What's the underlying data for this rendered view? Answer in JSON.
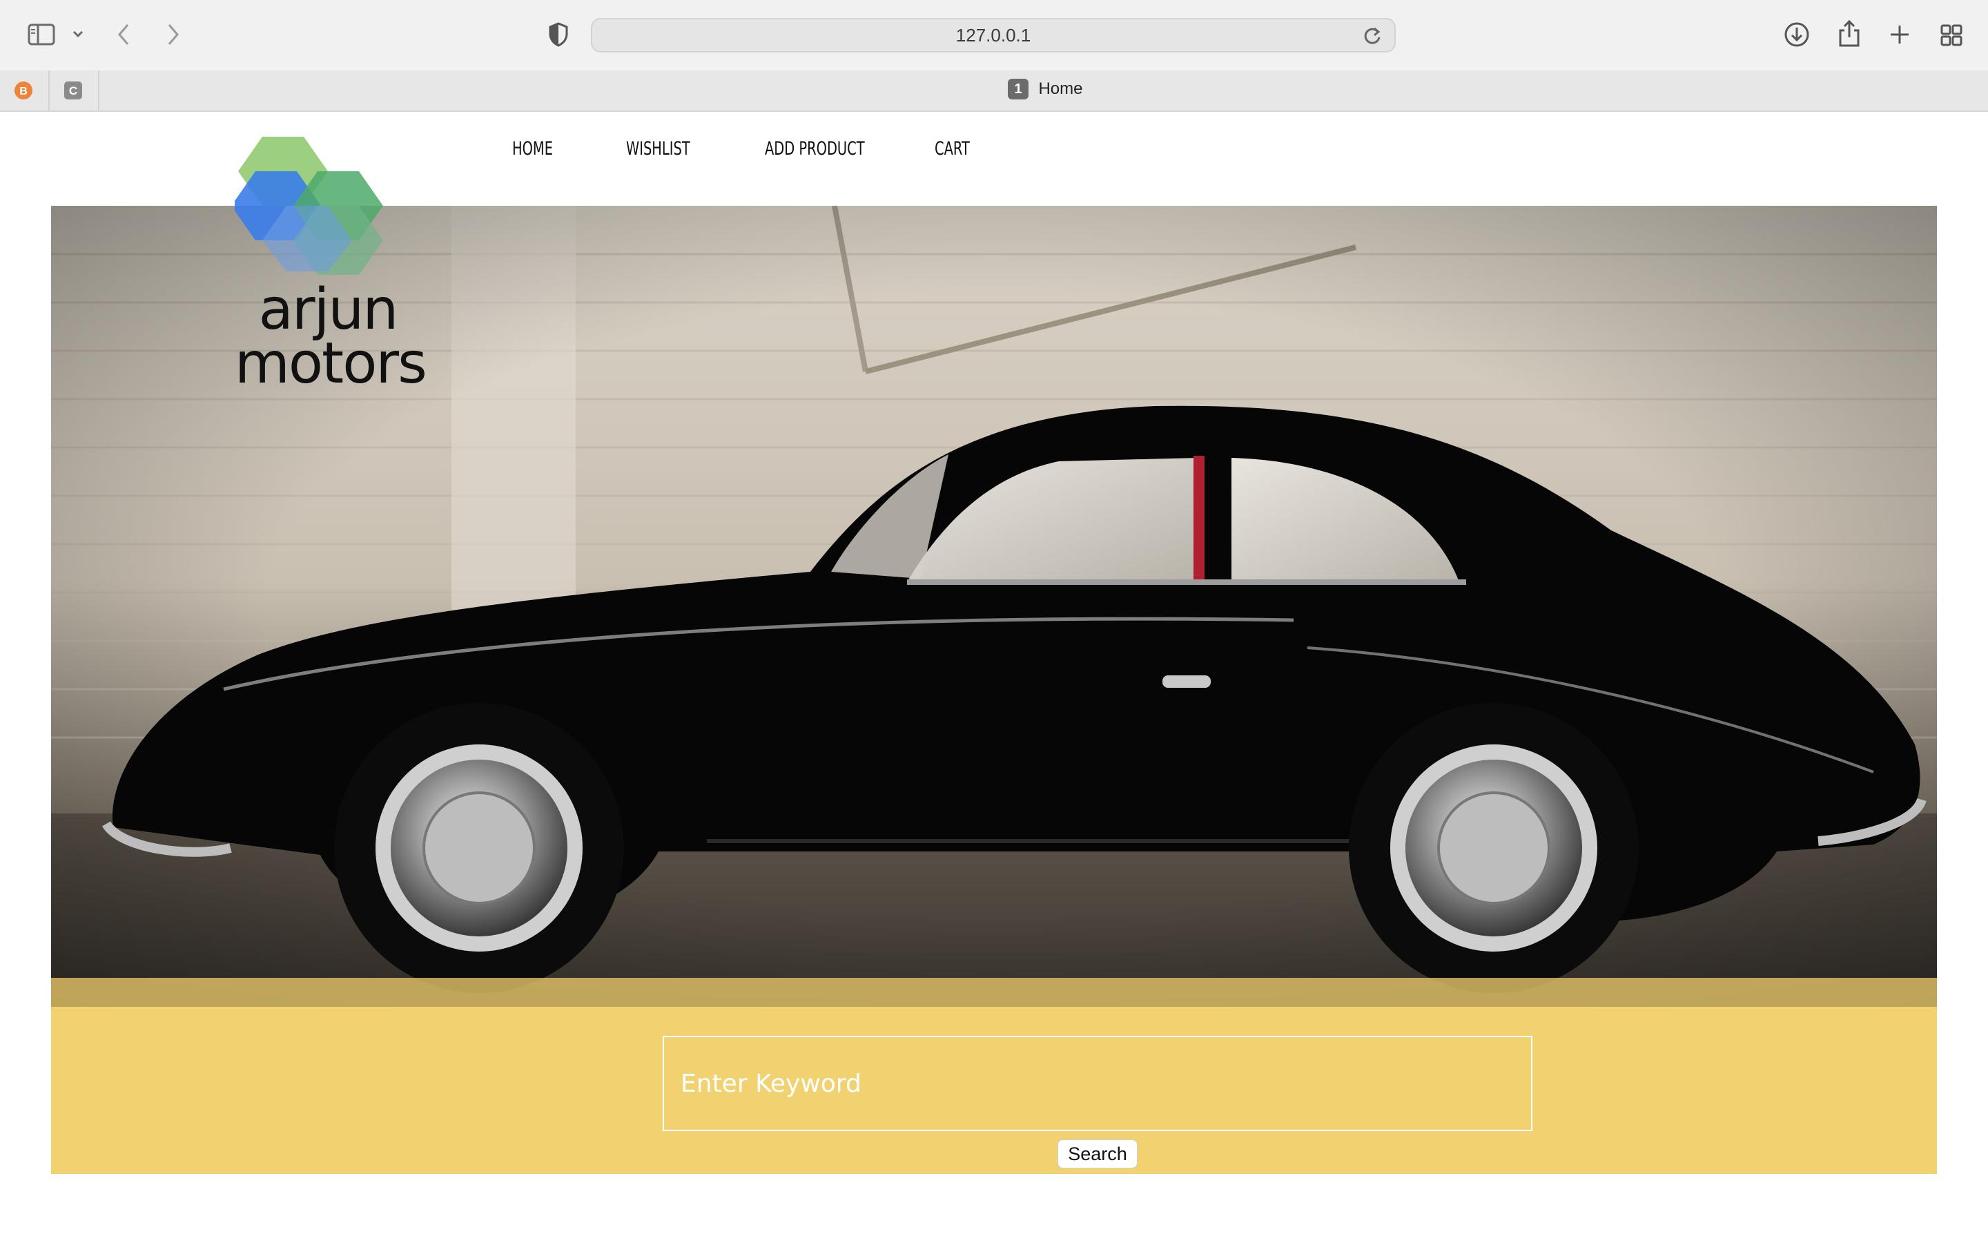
{
  "browser": {
    "url": "127.0.0.1",
    "tab": {
      "badge": "1",
      "title": "Home"
    },
    "icons": [
      "sidebar-icon",
      "chevron-down-icon",
      "back-icon",
      "forward-icon",
      "shield-icon",
      "reload-icon",
      "download-icon",
      "share-icon",
      "new-tab-icon",
      "tab-overview-icon"
    ]
  },
  "nav": {
    "items": [
      {
        "label": "HOME"
      },
      {
        "label": "WISHLIST"
      },
      {
        "label": "ADD PRODUCT"
      },
      {
        "label": "CART"
      }
    ]
  },
  "logo": {
    "line1": "arjun",
    "line2": "motors"
  },
  "search": {
    "placeholder": "Enter Keyword",
    "button_label": "Search"
  },
  "colors": {
    "search_band": "#f2d170",
    "logo_blue": "#3a7de8",
    "logo_green": "#5fae5c"
  }
}
